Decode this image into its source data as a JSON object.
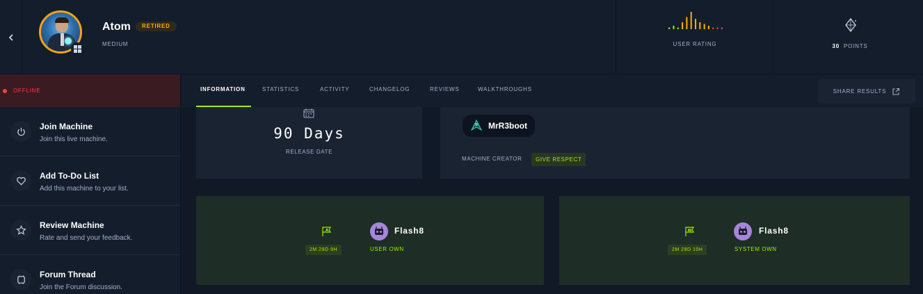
{
  "header": {
    "back_icon": "chevron-left-icon",
    "machine_name": "Atom",
    "status_badge": "RETIRED",
    "difficulty": "MEDIUM",
    "os_icon": "windows-icon",
    "user_rating": {
      "label": "USER RATING",
      "distribution": [
        1,
        2,
        1,
        4,
        7,
        10,
        6,
        4,
        3,
        2,
        1,
        1,
        1
      ],
      "colors": [
        "#9fef00",
        "#ffaf00",
        "#ff3e3e"
      ]
    },
    "points": {
      "value": "30",
      "label": "POINTS",
      "icon": "diamond-icon"
    }
  },
  "sidebar": {
    "status": "OFFLINE",
    "items": [
      {
        "title": "Join Machine",
        "subtitle": "Join this live machine.",
        "icon": "power-icon"
      },
      {
        "title": "Add To-Do List",
        "subtitle": "Add this machine to your list.",
        "icon": "heart-icon"
      },
      {
        "title": "Review Machine",
        "subtitle": "Rate and send your feedback.",
        "icon": "star-icon"
      },
      {
        "title": "Forum Thread",
        "subtitle": "Join the Forum discussion.",
        "icon": "forum-icon"
      }
    ]
  },
  "tabs": [
    "INFORMATION",
    "STATISTICS",
    "ACTIVITY",
    "CHANGELOG",
    "REVIEWS",
    "WALKTHROUGHS"
  ],
  "active_tab": "INFORMATION",
  "share_button": {
    "label": "SHARE RESULTS",
    "icon": "external-link-icon"
  },
  "release": {
    "value": "90 Days",
    "label": "RELEASE DATE",
    "icon": "calendar-icon"
  },
  "creator": {
    "name": "MrR3boot",
    "label": "MACHINE CREATOR",
    "respect_label": "GIVE RESPECT"
  },
  "user_blood": {
    "time": "2M 29D 9H",
    "user": "Flash8",
    "type": "USER OWN",
    "icon": "user-flag-icon"
  },
  "system_blood": {
    "time": "2M 29D 10H",
    "user": "Flash8",
    "type": "SYSTEM OWN",
    "icon": "system-flag-icon"
  },
  "accent_color": "#9fef00"
}
